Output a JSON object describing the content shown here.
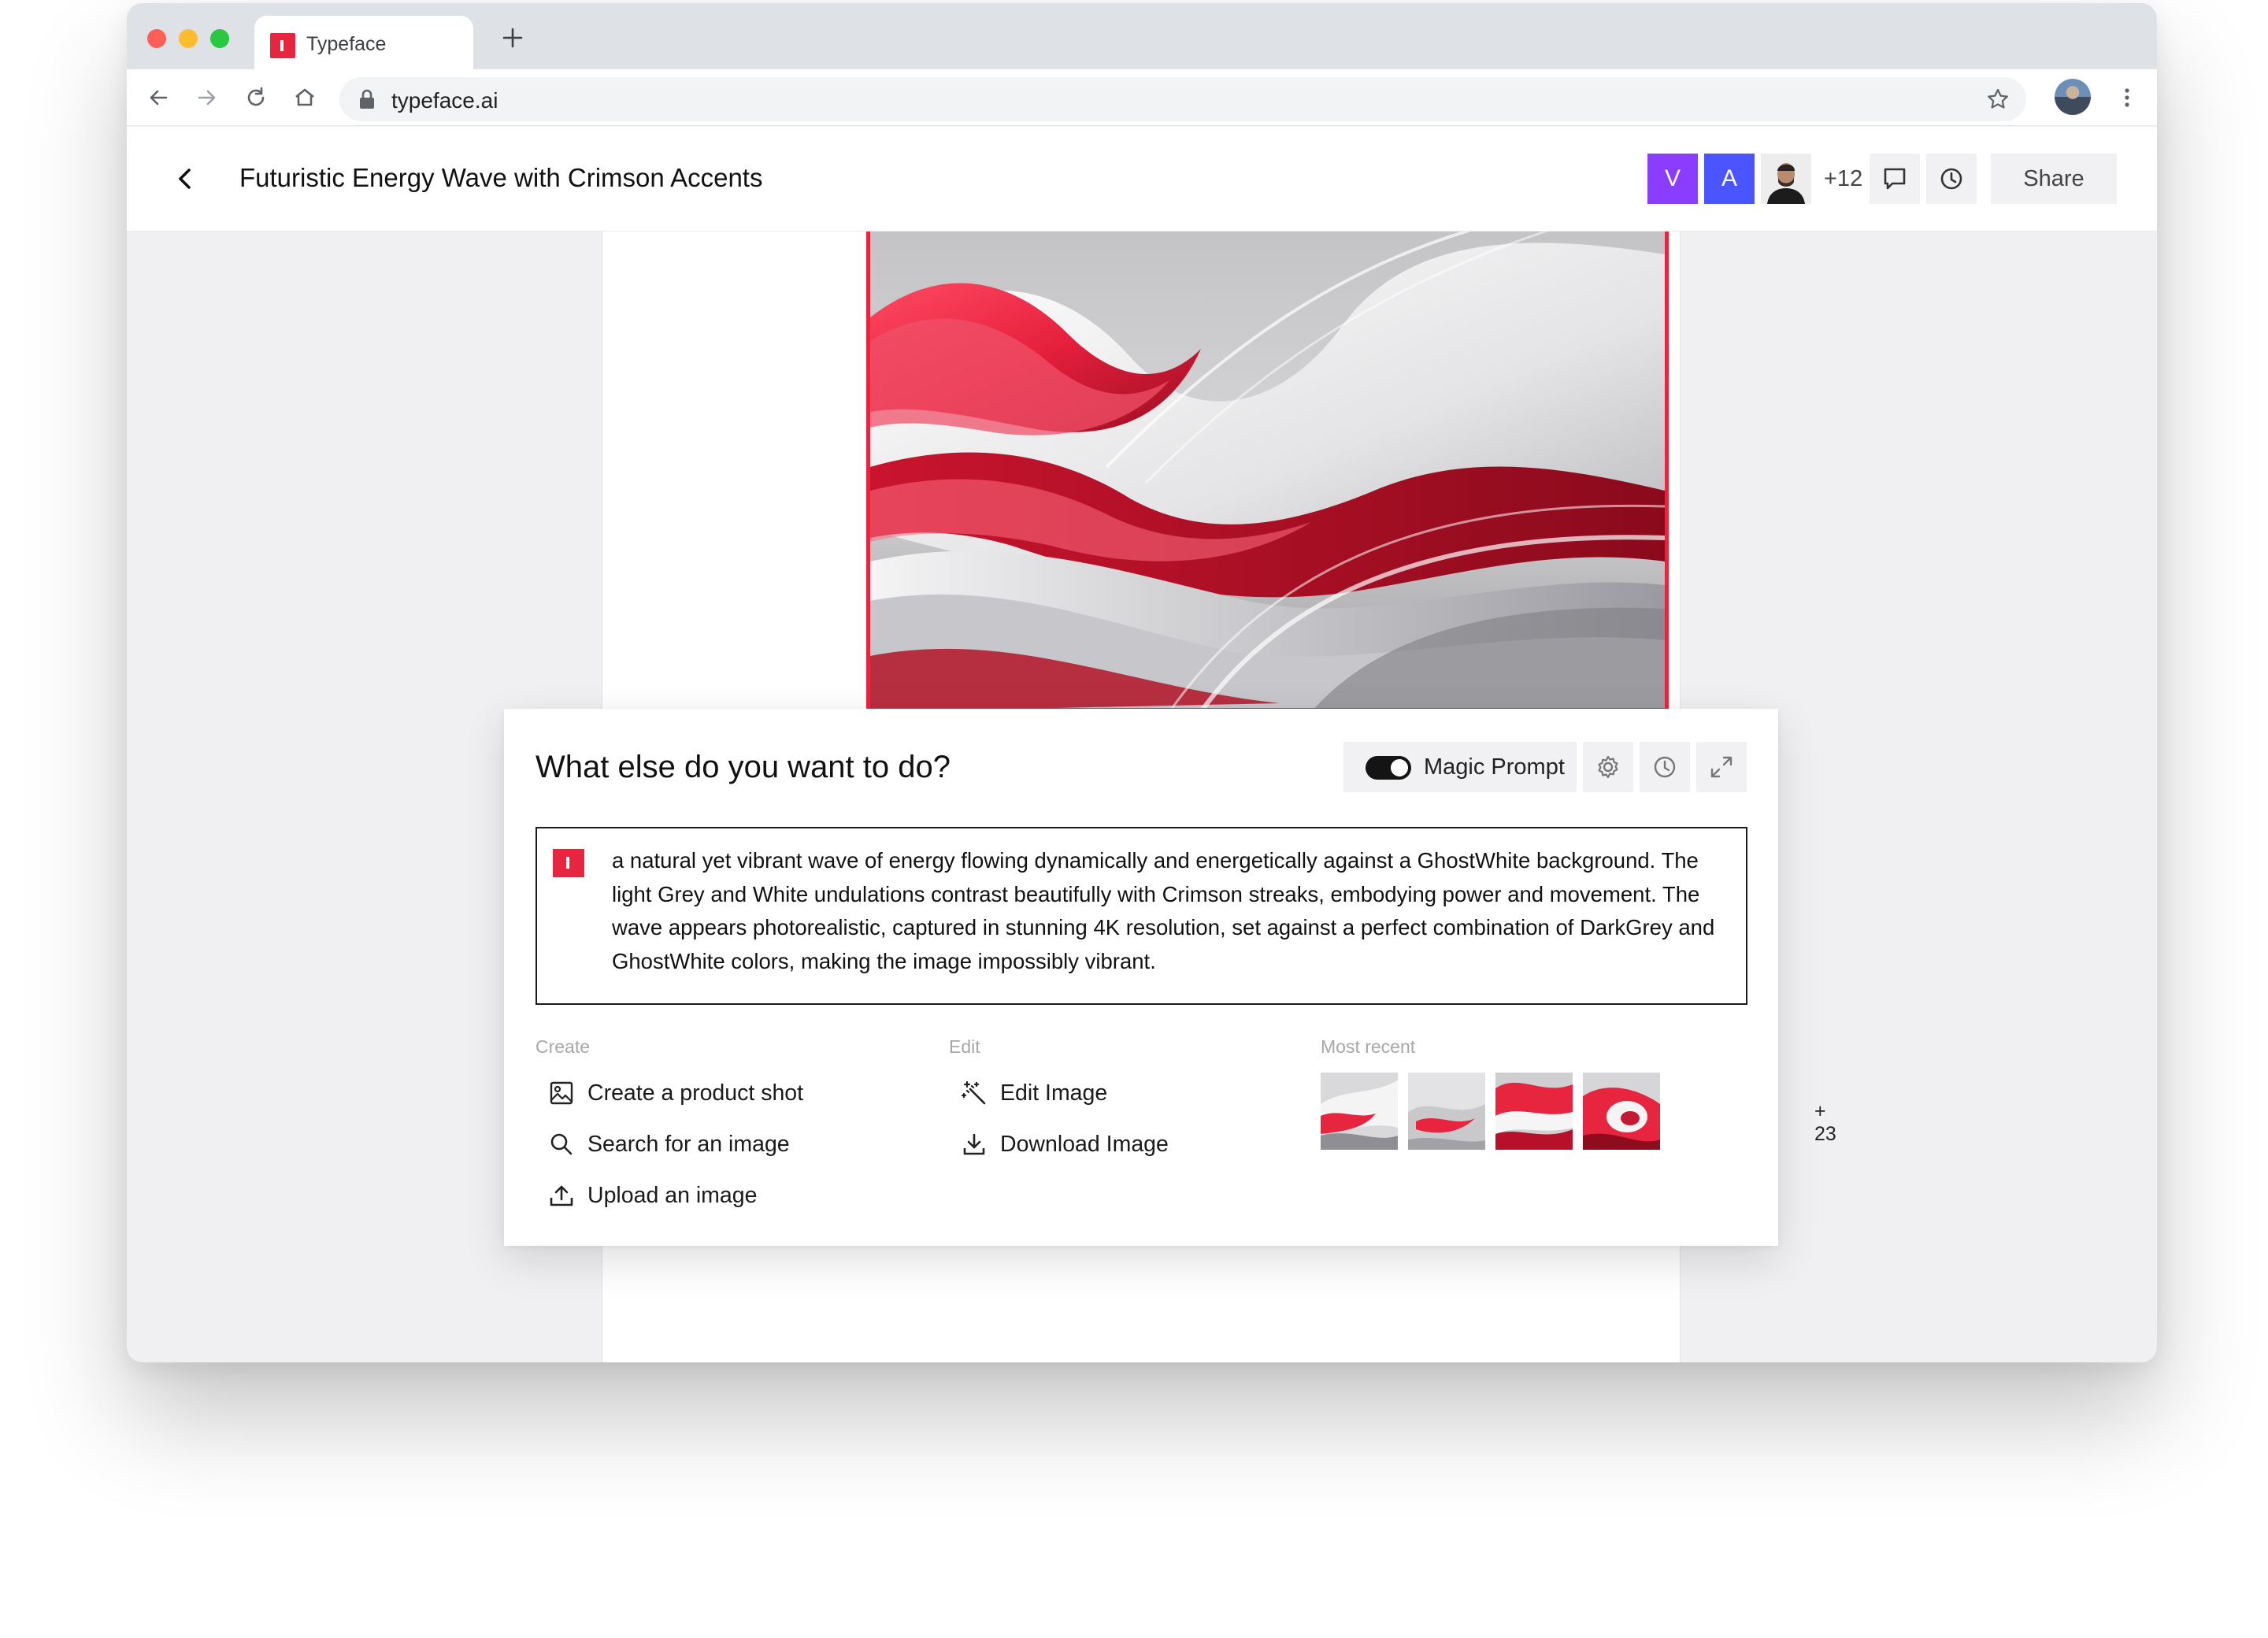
{
  "browser": {
    "tab_title": "Typeface",
    "url": "typeface.ai"
  },
  "header": {
    "title": "Futuristic Energy Wave with Crimson Accents",
    "collaborators": [
      "V",
      "A"
    ],
    "more_count": "+12",
    "share_label": "Share"
  },
  "panel": {
    "title": "What else do you want to do?",
    "magic_prompt_label": "Magic Prompt",
    "magic_prompt_on": true,
    "prompt_text": "a natural yet vibrant wave of energy flowing dynamically and energetically against a GhostWhite background. The light Grey and White undulations contrast beautifully with Crimson streaks, embodying power and movement. The wave appears photorealistic, captured in stunning 4K resolution, set against a perfect combination of DarkGrey and GhostWhite colors, making the image impossibly vibrant.",
    "create": {
      "heading": "Create",
      "items": [
        "Create a product shot",
        "Search for an image",
        "Upload an image"
      ]
    },
    "edit": {
      "heading": "Edit",
      "items": [
        "Edit Image",
        "Download Image"
      ]
    },
    "recent": {
      "heading": "Most recent",
      "more": "+ 23"
    }
  },
  "colors": {
    "brand_red": "#e8253f",
    "avatar_v": "#8b3dff",
    "avatar_a": "#4a55ff"
  },
  "icons": [
    "back-icon",
    "forward-icon",
    "reload-icon",
    "home-icon",
    "lock-icon",
    "star-icon",
    "kebab-icon",
    "chevron-left-icon",
    "comment-icon",
    "clock-icon",
    "gear-icon",
    "expand-icon",
    "image-icon",
    "search-icon",
    "upload-icon",
    "magic-wand-icon",
    "download-icon"
  ]
}
